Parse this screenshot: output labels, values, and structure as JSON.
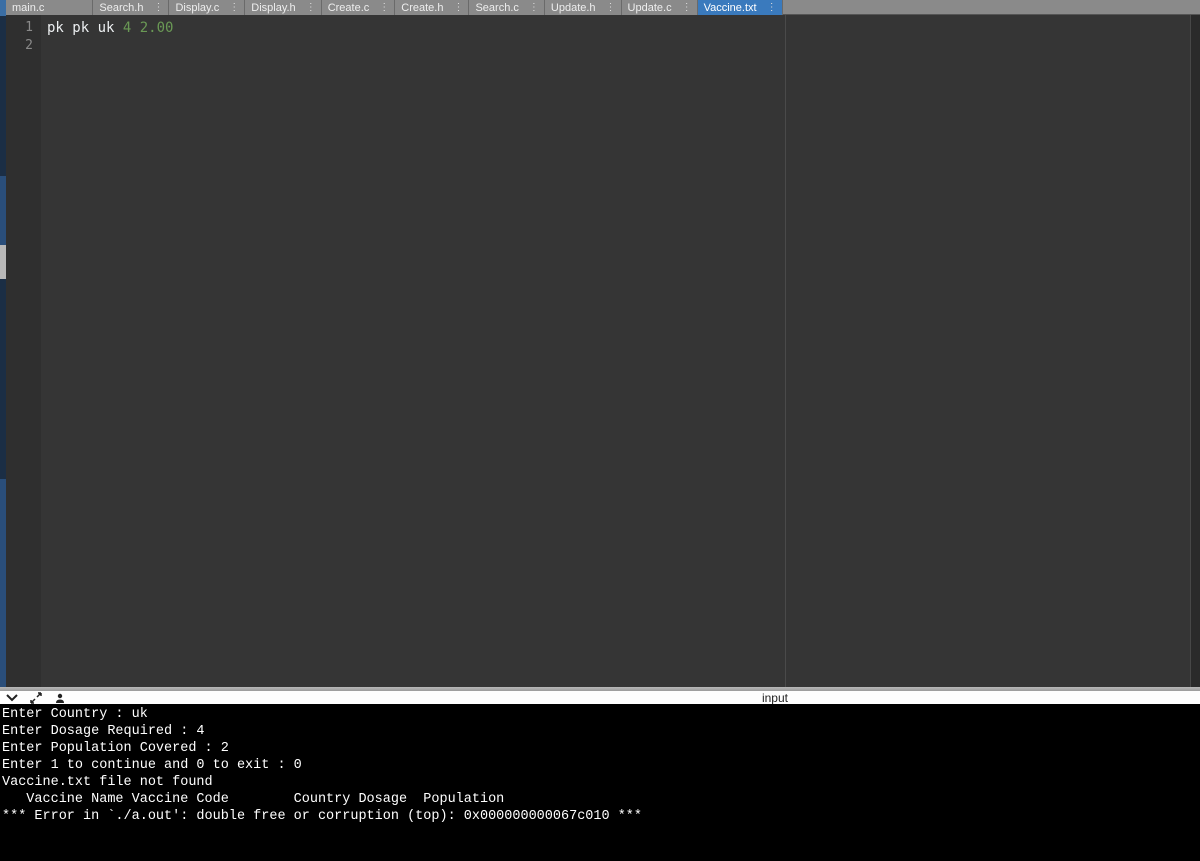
{
  "tabs": [
    {
      "label": "main.c",
      "active": false,
      "hasMenu": false
    },
    {
      "label": "Search.h",
      "active": false,
      "hasMenu": true
    },
    {
      "label": "Display.c",
      "active": false,
      "hasMenu": true
    },
    {
      "label": "Display.h",
      "active": false,
      "hasMenu": true
    },
    {
      "label": "Create.c",
      "active": false,
      "hasMenu": true
    },
    {
      "label": "Create.h",
      "active": false,
      "hasMenu": true
    },
    {
      "label": "Search.c",
      "active": false,
      "hasMenu": true
    },
    {
      "label": "Update.h",
      "active": false,
      "hasMenu": true
    },
    {
      "label": "Update.c",
      "active": false,
      "hasMenu": true
    },
    {
      "label": "Vaccine.txt",
      "active": true,
      "hasMenu": true
    }
  ],
  "editor": {
    "linenos": [
      "1",
      "2"
    ],
    "code": {
      "l1_a": "pk pk uk ",
      "l1_b": "4 2.00"
    }
  },
  "console_toolbar": {
    "input_label": "input"
  },
  "console": {
    "lines": [
      "Enter Country : uk",
      "Enter Dosage Required : 4",
      "Enter Population Covered : 2",
      "",
      "Enter 1 to continue and 0 to exit : 0",
      "Vaccine.txt file not found",
      "   Vaccine Name Vaccine Code        Country Dosage  Population",
      "*** Error in `./a.out': double free or corruption (top): 0x000000000067c010 ***"
    ]
  }
}
